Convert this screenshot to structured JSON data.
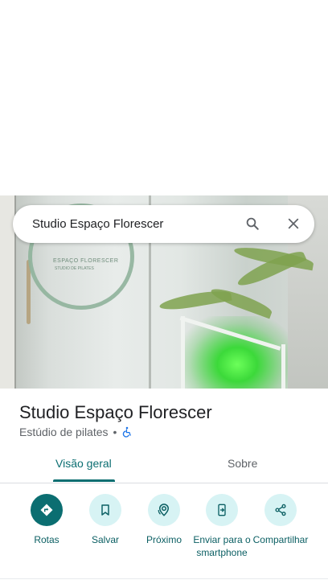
{
  "search": {
    "query": "Studio Espaço Florescer"
  },
  "photo": {
    "sign_text": "ESPAÇO FLORESCER",
    "sign_sub": "STUDIO DE PILATES"
  },
  "place": {
    "name": "Studio Espaço Florescer",
    "category": "Estúdio de pilates",
    "separator": "•",
    "accessibility_icon": "wheelchair-icon"
  },
  "tabs": [
    {
      "label": "Visão geral",
      "active": true
    },
    {
      "label": "Sobre",
      "active": false
    }
  ],
  "actions": [
    {
      "label": "Rotas",
      "icon": "directions-icon",
      "primary": true
    },
    {
      "label": "Salvar",
      "icon": "bookmark-icon",
      "primary": false
    },
    {
      "label": "Próximo",
      "icon": "nearby-icon",
      "primary": false
    },
    {
      "label": "Enviar para o smartphone",
      "icon": "send-to-phone-icon",
      "primary": false
    },
    {
      "label": "Compartilhar",
      "icon": "share-icon",
      "primary": false
    }
  ],
  "colors": {
    "accent": "#0b6e71",
    "action_bg": "#d7f3f4",
    "accessibility": "#1a73e8"
  }
}
